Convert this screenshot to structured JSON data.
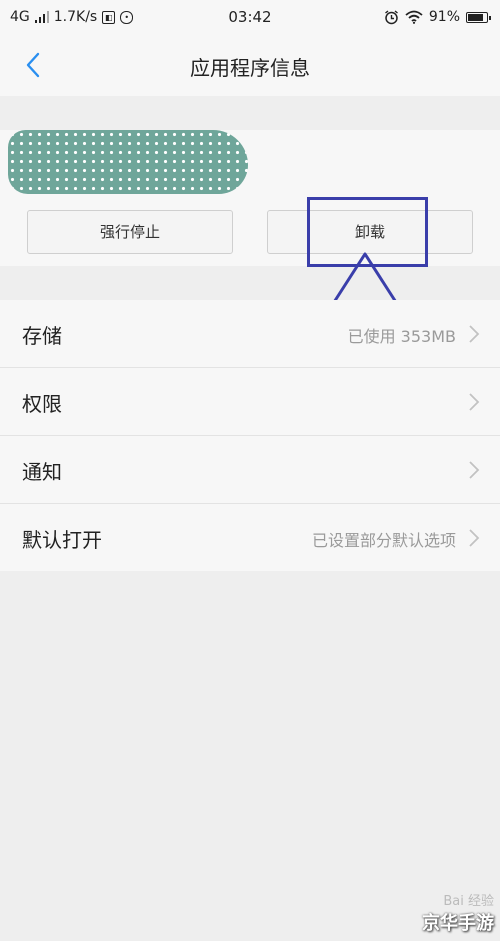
{
  "status_bar": {
    "network": "4G",
    "speed": "1.7K/s",
    "time": "03:42",
    "battery": "91%",
    "battery_level": 0.91,
    "icons": [
      "signal-icon",
      "sim-icon",
      "message-icon",
      "alarm-icon",
      "wifi-icon",
      "battery-icon"
    ]
  },
  "header": {
    "title": "应用程序信息"
  },
  "app": {
    "icon": "app-icon-obscured"
  },
  "buttons": {
    "force_stop": "强行停止",
    "uninstall": "卸载"
  },
  "settings": [
    {
      "label": "存储",
      "value": "已使用 353MB"
    },
    {
      "label": "权限",
      "value": ""
    },
    {
      "label": "通知",
      "value": ""
    },
    {
      "label": "默认打开",
      "value": "已设置部分默认选项"
    }
  ],
  "annotation": {
    "color": "#3a3eaa"
  },
  "watermark": {
    "baidu": "Bai 经验",
    "site": "京华手游"
  }
}
